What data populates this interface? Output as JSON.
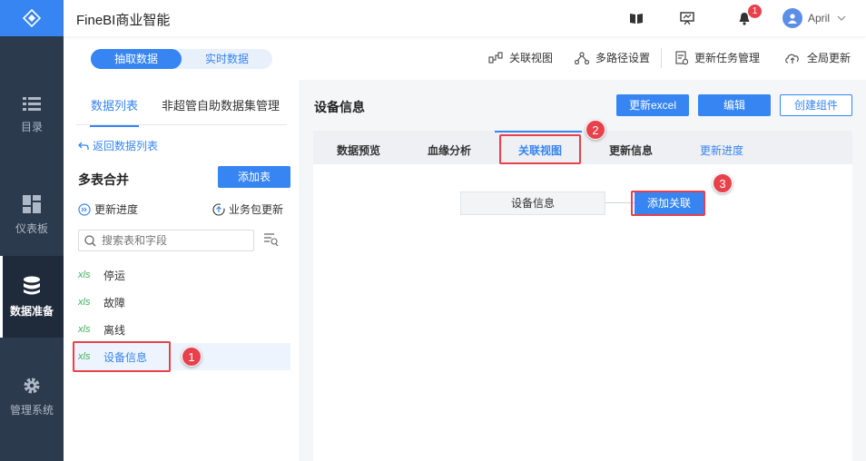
{
  "app": {
    "title": "FineBI商业智能"
  },
  "nav": {
    "items": [
      {
        "label": "目录",
        "icon": "list-icon"
      },
      {
        "label": "仪表板",
        "icon": "dashboard-icon"
      },
      {
        "label": "数据准备",
        "icon": "database-icon",
        "active": true
      },
      {
        "label": "管理系统",
        "icon": "gear-icon"
      }
    ]
  },
  "header": {
    "notification_count": "1",
    "user_name": "April"
  },
  "mode_toggle": {
    "active": "抽取数据",
    "inactive": "实时数据"
  },
  "toolbar": {
    "relation_view": "关联视图",
    "multipath": "多路径设置",
    "update_tasks": "更新任务管理",
    "global_update": "全局更新"
  },
  "left": {
    "tabs": [
      "数据列表",
      "非超管自助数据集管理"
    ],
    "back_link": "返回数据列表",
    "group_title": "多表合并",
    "add_table": "添加表",
    "update_progress": "更新进度",
    "package_update": "业务包更新",
    "search_placeholder": "搜索表和字段",
    "tables": [
      {
        "type": "xls",
        "name": "停运"
      },
      {
        "type": "xls",
        "name": "故障"
      },
      {
        "type": "xls",
        "name": "离线"
      },
      {
        "type": "xls",
        "name": "设备信息",
        "selected": true
      }
    ]
  },
  "right": {
    "title": "设备信息",
    "buttons": {
      "update_excel": "更新excel",
      "edit": "编辑",
      "create_component": "创建组件"
    },
    "tabs": [
      "数据预览",
      "血缘分析",
      "关联视图",
      "更新信息",
      "更新进度"
    ],
    "node_label": "设备信息",
    "add_relation": "添加关联"
  },
  "callouts": [
    "1",
    "2",
    "3"
  ],
  "colors": {
    "accent": "#3685f2",
    "nav_bg": "#2b3a4d",
    "callout": "#e8414b",
    "xls": "#42b05c"
  }
}
